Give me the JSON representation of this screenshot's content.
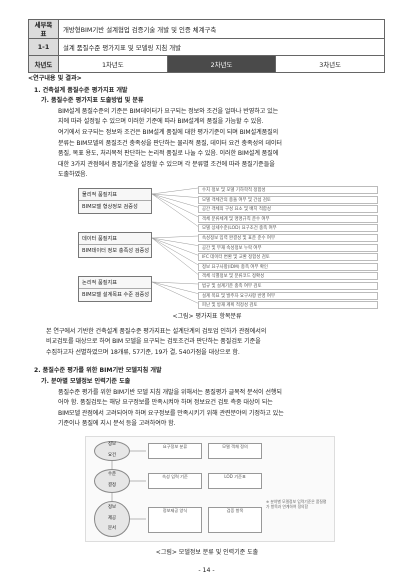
{
  "header": {
    "task_label": "세부목표",
    "task_value": "개방형BIM기반 설계협업 검증기술 개발 및 인증 체계구축",
    "item_label": "1-1",
    "item_value": "설계 품질수준 평가지표 및 모델링 지침 개발",
    "year_label": "차년도",
    "years": [
      "1차년도",
      "2차년도",
      "3차년도"
    ]
  },
  "section_title": "<연구내용 및 결과>",
  "s1": {
    "title": "1. 건축설계 품질수준 평가지표 개발",
    "sub": "가. 품질수준 평가지표 도출방법 및 분류",
    "para": [
      "BIM설계 품질수준의 기준은 BIM데이터가 요구되는 정보와 조건을 얼마나 반영하고 있는",
      "지에 따라 설정될 수 있으며 이러한 기준에 따라 BIM설계의 품질을 가늠할 수 있음.",
      "여기에서 요구되는 정보와 조건은 BIM설계 품질에 대한 평가기준이 되며 BIM설계품질의",
      "분류는 BIM모델의 품질조건 충족성을 판단하는 물리적 품질, 데이터 요건 충족성의 데이터",
      "품질, 목표 용도, 처리목적 판단하는 논리적 품질로 나눌 수 있음. 이러한 BIM설계 품질에",
      "대한 3가지 관점에서 품질기준을 설정할 수 있으며 각 분류별 조건에 따라 품질기준들을",
      "도출하였음."
    ],
    "diagram": {
      "categories": [
        [
          "물리적 품질지표",
          "BIM모델 형상정보 검증성"
        ],
        [
          "데이터 품질지표",
          "BIM데이터 정보 충족성 검증성"
        ],
        [
          "논리적 품질지표",
          "BIM모델 설계목표 수준 검증성"
        ]
      ],
      "items": [
        [
          "수치 정보 및 모델 기하학적 정합성",
          "모델 객체간의 충돌 여부 및 간섭 검토",
          "공간 객체의 구성 요소 및 배치 적합성",
          "객체 분류체계 및 명명규칙 준수 여부",
          "모델 상세수준(LOD) 요구조건 충족 여부"
        ],
        [
          "속성정보 입력 완결성 및 표준 준수 여부",
          "공간 및 부재 속성정보 누락 여부",
          "IFC 데이터 변환 및 교환 정합성 검토",
          "정보 요구사항(IDM) 충족 여부 확인",
          "객체 식별정보 및 분류코드 정확성"
        ],
        [
          "법규 및 설계기준 충족 여부 검토",
          "설계 목표 및 발주자 요구사항 반영 여부",
          "피난 및 방재 계획 적정성 검토",
          "에너지 및 친환경 성능 검증"
        ]
      ]
    },
    "caption": "<그림> 평가지표 항목분류",
    "para2": [
      "본 연구에서 기반한 건축설계 품질수준 평가지표는 설계단계의 검토업 인하가 관점에서의",
      "비교검토를 대상으로 하여 BIM 모델을 요구되는 검토조건과 판단하는 품질검토 기준을",
      "수집하고자 선별하였으며 18개류, 57기준, 19가 결, 540가점을 대상으로 함."
    ]
  },
  "s2": {
    "title": "2. 품질수준 평가를 위한 BIM기반 모델지침 개발",
    "sub": "가. 분야별 모델정보 인력기준 도출",
    "para": [
      "품질수준 평가를 위한 BIM기반 모델 지침 개발을 위해서는 품질평가 글목적 분석이 선행되",
      "어야 함. 품질검토는 해당 요구정보를 만족시켜야 하며 정보요건 검토 측중 대상이 되는",
      "BIM모델 관점에서 고려되어야 하며 요구정보를 만족시키기 위해 관련분야의 기정하고 있는",
      "기준이나 품질에 지시 분석 등을 고려하여야 함."
    ],
    "diagram": {
      "ovals": [
        "정보\n요건",
        "수준\n결정",
        "정보\n제공\n문서"
      ],
      "boxes": [
        "요구정보 분류",
        "모델 객체 정의",
        "속성 입력 기준",
        "LOD 기준표",
        "정보제공 양식",
        "검증 항목"
      ],
      "note": "※ 분야별 모델정보 입력기준은 품질평가 항목과 연계하여 정의함"
    },
    "caption": "<그림> 모델정보 분류 및 인력기준 도출"
  },
  "page_number": "- 14 -"
}
